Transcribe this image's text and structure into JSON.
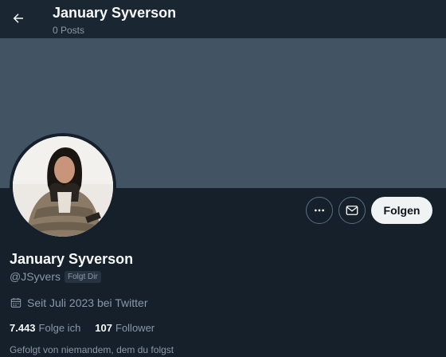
{
  "header": {
    "title": "January Syverson",
    "posts": "0 Posts"
  },
  "profile": {
    "name": "January Syverson",
    "handle": "@JSyvers",
    "follows_you_badge": "Folgt Dir",
    "joined": "Seit Juli 2023 bei Twitter",
    "following_count": "7.443",
    "following_label": "Folge ich",
    "followers_count": "107",
    "followers_label": "Follower",
    "followed_by_text": "Gefolgt von niemandem, dem du folgst"
  },
  "actions": {
    "follow_label": "Folgen"
  },
  "icons": {
    "back": "arrow-left-icon",
    "more": "more-icon",
    "message": "envelope-icon",
    "calendar": "calendar-icon"
  },
  "colors": {
    "background": "#15202b",
    "banner": "#425364",
    "follow_button": "#eff3f4",
    "secondary_text": "#8b98a5"
  }
}
